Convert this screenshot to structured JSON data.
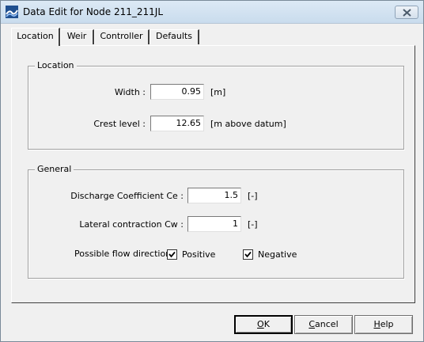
{
  "window": {
    "title": "Data Edit for Node 211_211JL"
  },
  "tabs": [
    {
      "label": "Location",
      "active": true
    },
    {
      "label": "Weir",
      "active": false
    },
    {
      "label": "Controller",
      "active": false
    },
    {
      "label": "Defaults",
      "active": false
    }
  ],
  "location_group": {
    "title": "Location",
    "width": {
      "label": "Width :",
      "value": "0.95",
      "unit": "[m]"
    },
    "crest_level": {
      "label": "Crest level :",
      "value": "12.65",
      "unit": "[m above datum]"
    }
  },
  "general_group": {
    "title": "General",
    "discharge_coefficient": {
      "label": "Discharge Coefficient Ce :",
      "value": "1.5",
      "unit": "[-]"
    },
    "lateral_contraction": {
      "label": "Lateral contraction Cw :",
      "value": "1",
      "unit": "[-]"
    },
    "flow_direction": {
      "label": "Possible flow direction :",
      "positive": {
        "label": "Positive",
        "checked": true
      },
      "negative": {
        "label": "Negative",
        "checked": true
      }
    }
  },
  "buttons": {
    "ok": {
      "first": "O",
      "rest": "K"
    },
    "cancel": {
      "first": "C",
      "rest": "ancel"
    },
    "help": {
      "first": "H",
      "rest": "elp"
    }
  },
  "colors": {
    "titlebar": "#c9dced",
    "dialog_bg": "#f0f0f0",
    "field_bg": "#ffffff"
  }
}
